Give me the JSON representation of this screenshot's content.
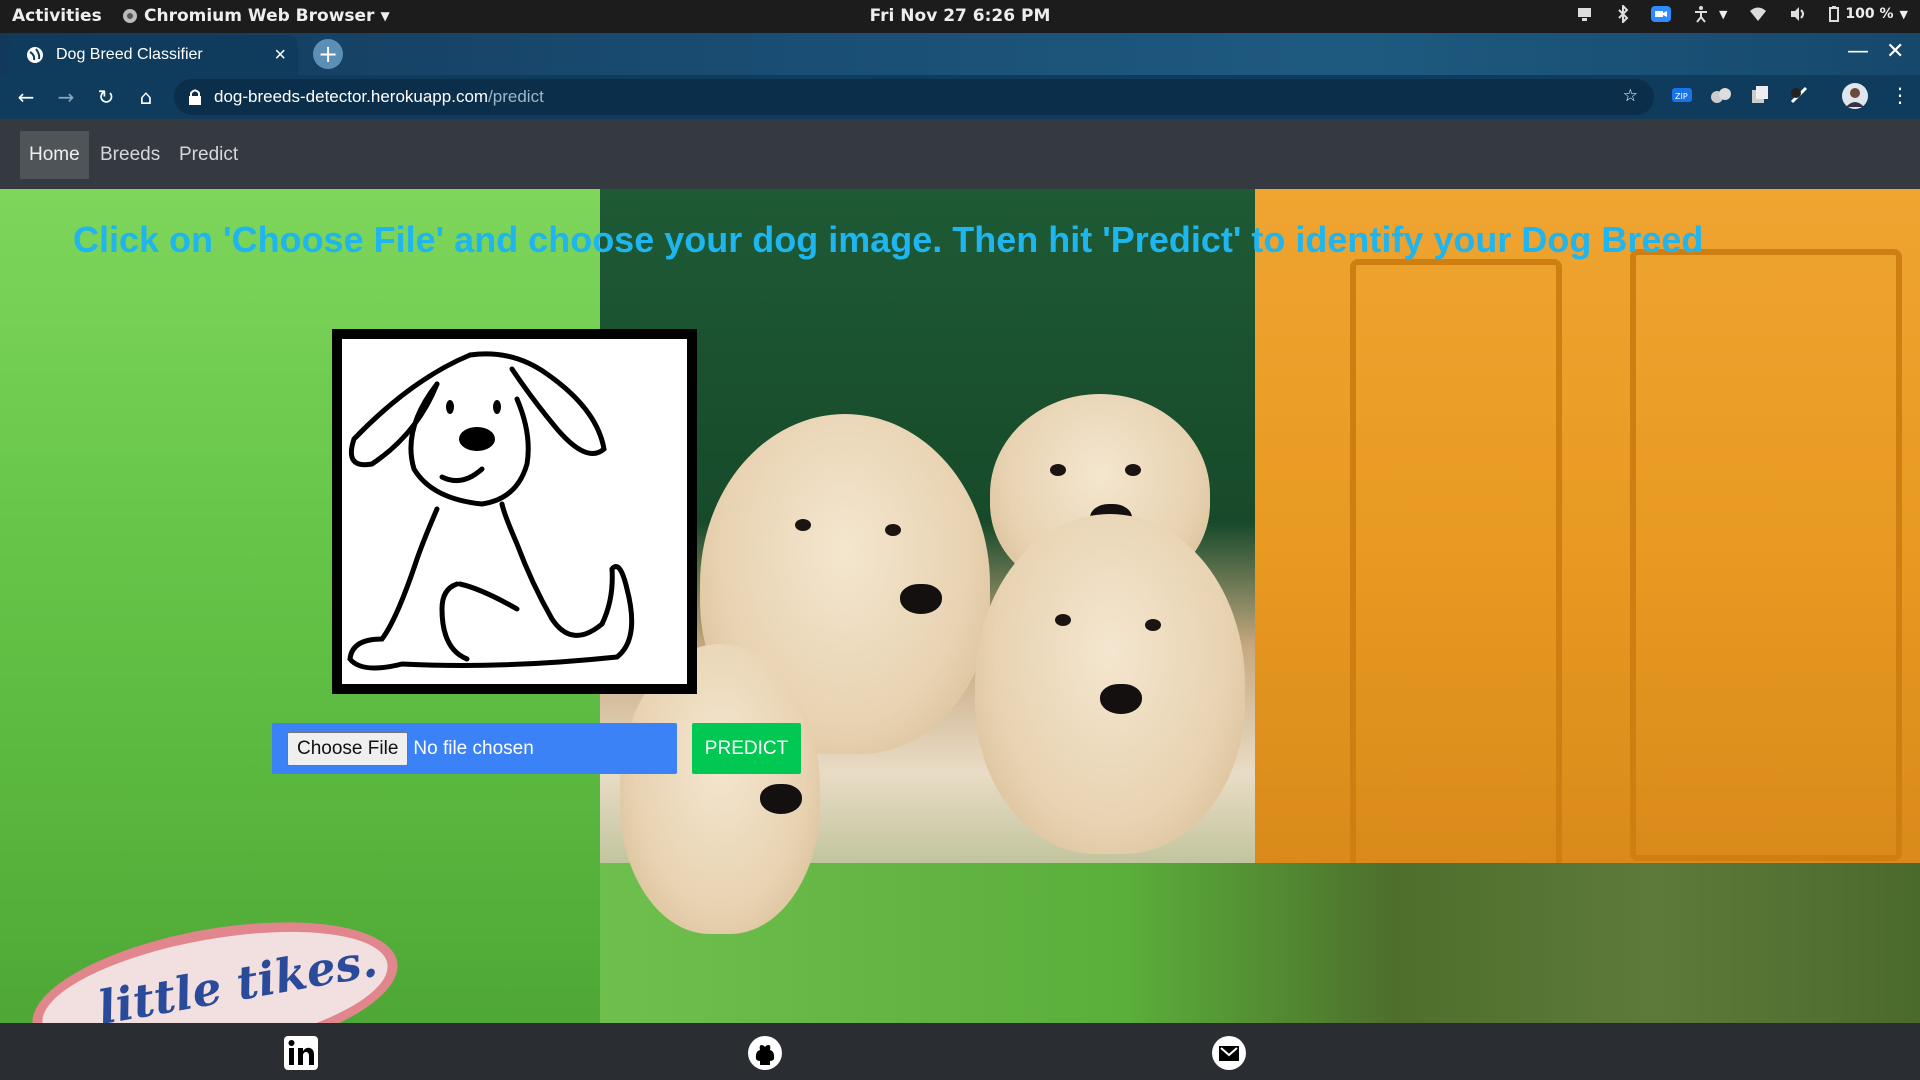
{
  "topbar": {
    "activities": "Activities",
    "app_name": "Chromium Web Browser",
    "clock": "Fri Nov 27   6:26 PM",
    "battery": "100 %"
  },
  "browser": {
    "tab_title": "Dog Breed Classifier",
    "url_host": "dog-breeds-detector.herokuapp.com",
    "url_path": "/predict"
  },
  "site": {
    "nav": [
      "Home",
      "Breeds",
      "Predict"
    ],
    "headline": "Click on 'Choose File' and choose your dog image. Then hit 'Predict' to identify your Dog Breed",
    "choose_file": "Choose File",
    "file_status": "No file chosen",
    "predict_button": "PREDICT",
    "badge_text": "little tikes."
  },
  "colors": {
    "headline": "#1fb5ee",
    "file_input_bg": "#3b82f6",
    "predict_bg": "#00c853",
    "navbar_bg": "#343a40",
    "footer_bg": "#2a2d31"
  },
  "footer_icons": [
    "linkedin-icon",
    "github-icon",
    "gmail-icon"
  ]
}
